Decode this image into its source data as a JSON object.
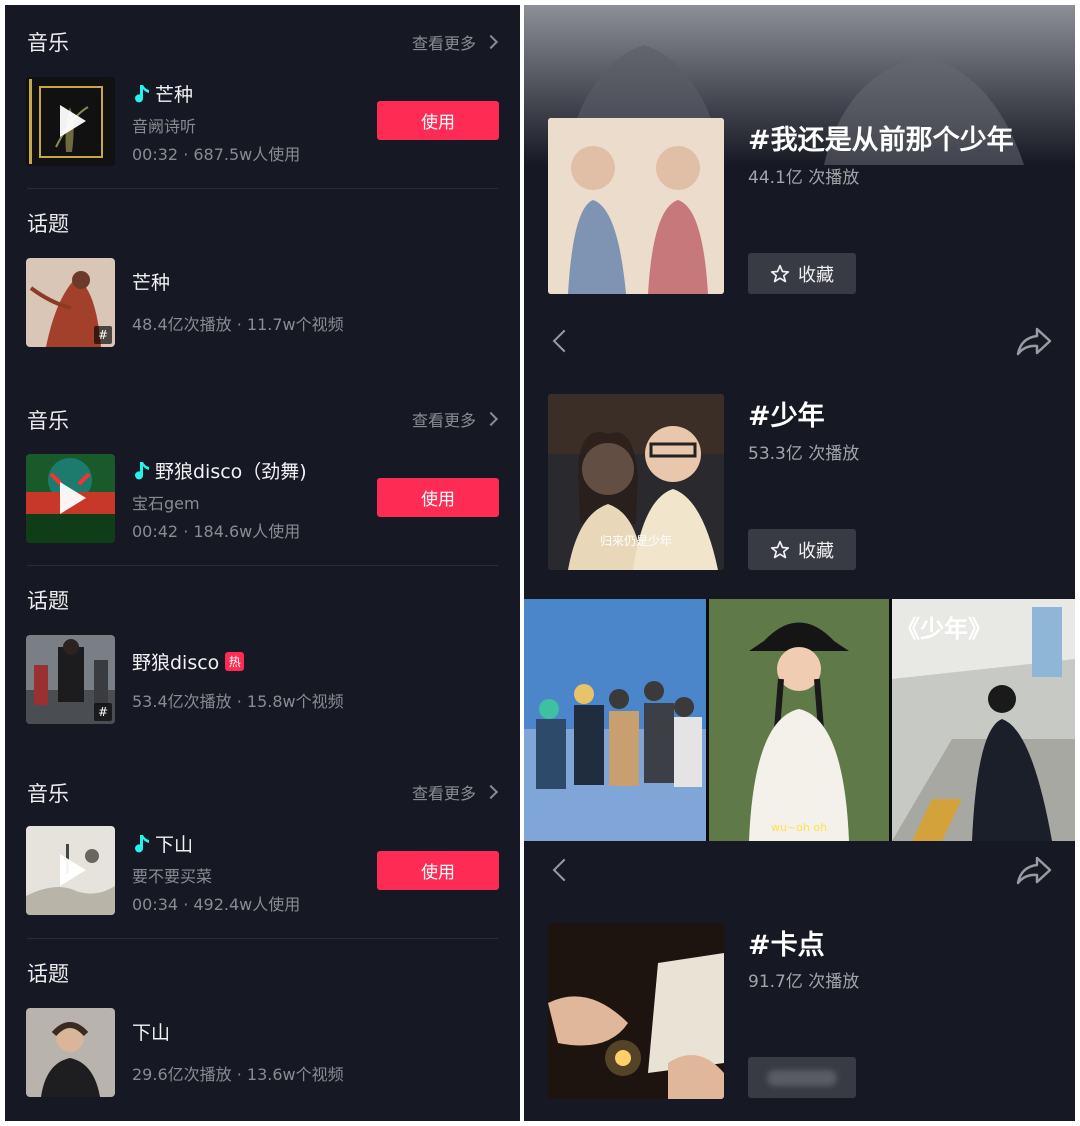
{
  "left": {
    "sections": [
      {
        "type": "music",
        "title": "音乐",
        "see_more": "查看更多",
        "song": "芒种",
        "artist": "音阙诗听",
        "meta": "00:32 · 687.5w人使用",
        "use_label": "使用"
      },
      {
        "type": "topic",
        "title": "话题",
        "name": "芒种",
        "meta": "48.4亿次播放 · 11.7w个视频"
      },
      {
        "type": "music",
        "title": "音乐",
        "see_more": "查看更多",
        "song": "野狼disco（劲舞)",
        "artist": "宝石gem",
        "meta": "00:42 · 184.6w人使用",
        "use_label": "使用"
      },
      {
        "type": "topic",
        "title": "话题",
        "name": "野狼disco",
        "hot": "热",
        "meta": "53.4亿次播放 · 15.8w个视频"
      },
      {
        "type": "music",
        "title": "音乐",
        "see_more": "查看更多",
        "song": "下山",
        "artist": "要不要买菜",
        "meta": "00:34 · 492.4w人使用",
        "use_label": "使用"
      },
      {
        "type": "topic",
        "title": "话题",
        "name": "下山",
        "meta": "29.6亿次播放 · 13.6w个视频"
      }
    ],
    "hash_symbol": "#"
  },
  "right": {
    "topics": [
      {
        "title": "#我还是从前那个少年",
        "plays": "44.1亿 次播放",
        "fav_label": "收藏"
      },
      {
        "title": "#少年",
        "plays": "53.3亿 次播放",
        "fav_label": "收藏",
        "thumb_caption": "归来仍是少年"
      },
      {
        "title": "#卡点",
        "plays": "91.7亿 次播放"
      }
    ],
    "collage_text": "《少年》",
    "collage_caption": "wu~oh oh"
  },
  "colors": {
    "background": "#161823",
    "accent": "#fe2c55",
    "secondary_text": "#8a8b91",
    "fav_button": "#393b44"
  },
  "icons": [
    "play-icon",
    "music-note-icon",
    "chevron-right-icon",
    "hashtag-icon",
    "star-icon",
    "back-icon",
    "share-icon"
  ]
}
